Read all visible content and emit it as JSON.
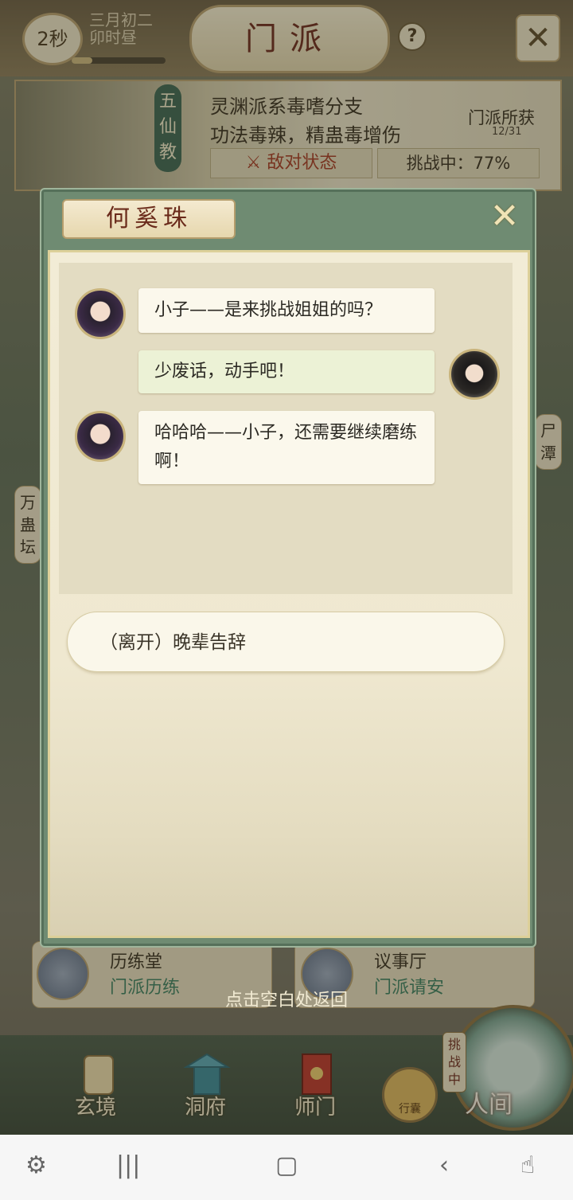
{
  "topbar": {
    "timer": "2秒",
    "date_line1": "三月初二",
    "date_line2": "卯时昼",
    "title": "门派",
    "help": "?",
    "close_icon": "close-icon"
  },
  "sect": {
    "badge": "五仙教",
    "desc1": "灵渊派系毒嗜分支",
    "desc2": "功法毒辣，精蛊毒增伤",
    "reward_label": "门派所获",
    "reward_count": "12/31",
    "hostile_label": "敌对状态",
    "challenge_label": "挑战中：77%",
    "challenge_progress": 77
  },
  "side_tags": {
    "right": "尸潭",
    "left": "万蛊坛"
  },
  "dialog": {
    "npc_name": "何奚珠",
    "messages": [
      {
        "speaker": "npc",
        "text": "小子——是来挑战姐姐的吗？"
      },
      {
        "speaker": "player",
        "text": "少废话，动手吧！"
      },
      {
        "speaker": "npc",
        "text": "哈哈哈——小子，还需要继续磨练啊！"
      }
    ],
    "choice": "（离开）晚辈告辞",
    "return_hint": "点击空白处返回"
  },
  "halls": [
    {
      "name": "历练堂",
      "sub": "门派历练"
    },
    {
      "name": "议事厅",
      "sub": "门派请安"
    }
  ],
  "nav": {
    "items": [
      "玄境",
      "洞府",
      "师门"
    ],
    "bag": "行囊",
    "world": "人间",
    "world_flag": "挑战中"
  },
  "colors": {
    "dialog_frame": "#6f8b72",
    "paper": "#f2ecd6",
    "hostile": "#a43a22",
    "accent_green": "#3d7d5e"
  }
}
